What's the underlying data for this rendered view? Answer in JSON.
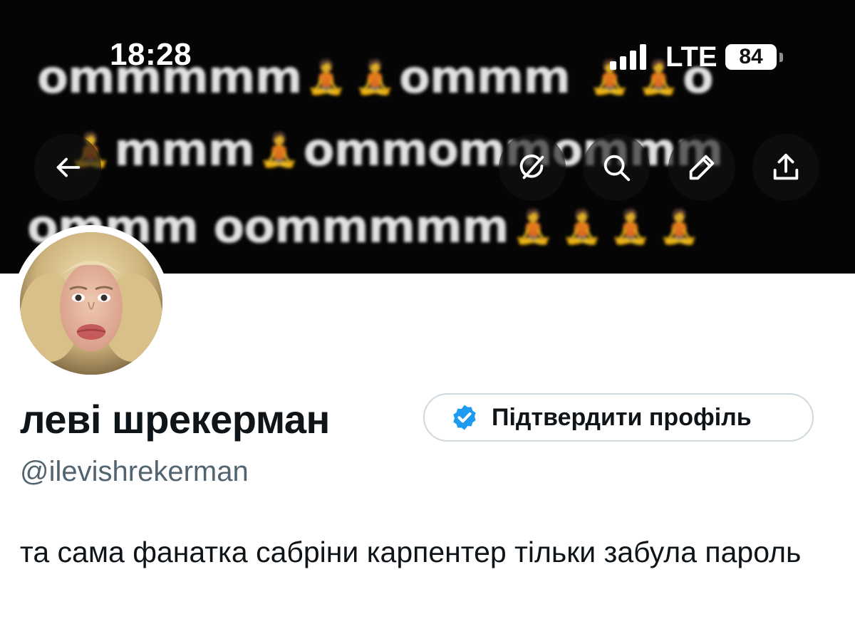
{
  "status_bar": {
    "time": "18:28",
    "network": "LTE",
    "battery": "84"
  },
  "banner": {
    "lines": [
      [
        "ommmmm",
        "🧘",
        "🧘",
        "ommm",
        "🧘",
        "🧘",
        "o"
      ],
      [
        "🧘",
        "mmm",
        "🧘",
        "ommommommm"
      ],
      [
        "ommm oommmmm",
        "🧘",
        "🧘",
        "🧘",
        "🧘"
      ]
    ]
  },
  "header_buttons": {
    "back": "arrow-left-icon",
    "grok": "grok-icon",
    "search": "search-icon",
    "edit": "pencil-icon",
    "share": "share-icon"
  },
  "profile": {
    "display_name": "леві шрекерман",
    "verify_button_label": "Підтвердити профіль",
    "handle": "@ilevishrekerman",
    "bio": "та сама фанатка сабріни карпентер тільки забула пароль"
  },
  "colors": {
    "verified_blue": "#1d9bf0",
    "handle_gray": "#536471",
    "text": "#0f1419",
    "border": "#cfd9de"
  }
}
